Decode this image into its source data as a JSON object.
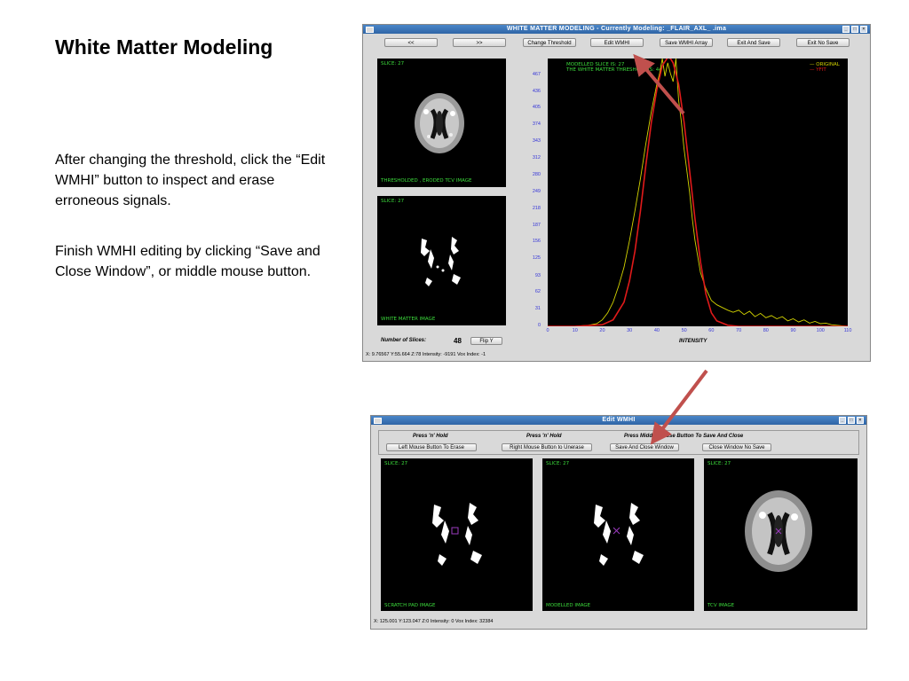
{
  "slide": {
    "title": "White Matter Modeling",
    "paragraph1": "After changing the threshold, click the “Edit WMHI” button to inspect and erase erroneous signals.",
    "paragraph2": "Finish WMHI editing by clicking “Save and Close Window”, or middle mouse button."
  },
  "colors": {
    "accent_arrow": "#c0504d",
    "panel_text": "#3cdc3c",
    "axis_text": "#3535d8",
    "titlebar": "#3a75b8"
  },
  "main_window": {
    "title": "WHITE MATTER MODELING  -  Currently Modeling:          _FLAIR_AXL_          .ima",
    "buttons": {
      "prev": "<<",
      "next": ">>",
      "change_threshold": "Change Threshold",
      "edit_wmhi": "Edit WMHI",
      "save_wmhi_array": "Save WMHI Array",
      "exit_and_save": "Exit And Save",
      "exit_no_save": "Exit No Save"
    },
    "top_panel": {
      "slice": "SLICE: 27",
      "caption": "THRESHOLDED , ERODED TCV IMAGE"
    },
    "bottom_panel": {
      "slice": "SLICE: 27",
      "caption": "WHITE MATTER IMAGE"
    },
    "num_slices_label": "Number of Slices:",
    "num_slices_value": "48",
    "flip_button": "Flip Y",
    "status": "X: 9.76567  Y:55.664  Z:78   Intensity: -9191   Vox Index: -1"
  },
  "chart_data": {
    "type": "line",
    "header_lines": [
      "MODELLED SLICE IS: 27",
      "THE WHITE MATTER THRESHOLD IS: 44"
    ],
    "xlabel": "INTENSITY",
    "ylabel": "",
    "xlim": [
      0,
      110
    ],
    "ylim": [
      0,
      498
    ],
    "x_ticks": [
      "0",
      "10",
      "20",
      "30",
      "40",
      "50",
      "60",
      "70",
      "80",
      "90",
      "100",
      "110"
    ],
    "y_ticks": [
      "0",
      "31",
      "62",
      "93",
      "125",
      "156",
      "187",
      "218",
      "249",
      "280",
      "312",
      "343",
      "374",
      "405",
      "436",
      "467"
    ],
    "legend_position": "top-right",
    "grid": false,
    "series": [
      {
        "name": "ORIGINAL",
        "color": "#d4d400",
        "x": [
          0,
          5,
          10,
          15,
          18,
          20,
          22,
          24,
          26,
          28,
          30,
          32,
          34,
          36,
          38,
          40,
          41,
          42,
          43,
          44,
          45,
          46,
          47,
          48,
          49,
          50,
          51,
          52,
          53,
          54,
          55,
          56,
          58,
          60,
          62,
          64,
          66,
          68,
          70,
          72,
          74,
          76,
          78,
          80,
          82,
          84,
          86,
          88,
          90,
          92,
          94,
          96,
          98,
          100,
          102,
          104,
          106,
          108,
          110
        ],
        "y": [
          0,
          0,
          0,
          2,
          5,
          12,
          25,
          45,
          75,
          110,
          160,
          215,
          275,
          340,
          400,
          450,
          470,
          498,
          465,
          490,
          470,
          455,
          498,
          420,
          380,
          330,
          290,
          250,
          200,
          160,
          130,
          100,
          70,
          48,
          40,
          35,
          30,
          26,
          30,
          22,
          28,
          18,
          24,
          16,
          20,
          14,
          18,
          10,
          14,
          8,
          12,
          6,
          9,
          5,
          6,
          3,
          2,
          1,
          0
        ]
      },
      {
        "name": "YFIT",
        "color": "#e01a1a",
        "x": [
          0,
          10,
          20,
          24,
          28,
          30,
          32,
          34,
          36,
          38,
          40,
          42,
          44,
          45,
          46,
          48,
          50,
          52,
          54,
          56,
          58,
          60,
          62,
          66,
          70,
          80,
          90,
          110
        ],
        "y": [
          0,
          0,
          3,
          12,
          45,
          85,
          140,
          215,
          300,
          380,
          440,
          485,
          500,
          498,
          490,
          450,
          380,
          290,
          200,
          120,
          60,
          25,
          10,
          2,
          0,
          0,
          0,
          0
        ]
      }
    ]
  },
  "edit_window": {
    "title": "Edit WMHI",
    "hint_left": "Press 'n' Hold",
    "hint_middle": "Press 'n' Hold",
    "hint_right": "Press Middle Mouse Button To Save And Close",
    "buttons": {
      "left_erase": "Left Mouse Button To Erase",
      "right_unerase": "Right Mouse Button to Unerase",
      "save_close": "Save And Close Window",
      "close_no_save": "Close Window No Save"
    },
    "panels": [
      {
        "slice": "SLICE: 27",
        "caption": "SCRATCH PAD IMAGE"
      },
      {
        "slice": "SLICE: 27",
        "caption": "MODELLED IMAGE"
      },
      {
        "slice": "SLICE: 27",
        "caption": "TCV IMAGE"
      }
    ],
    "status": "X: 125.001  Y:123.047  Z:0   Intensity: 0   Vox Index: 32384"
  }
}
